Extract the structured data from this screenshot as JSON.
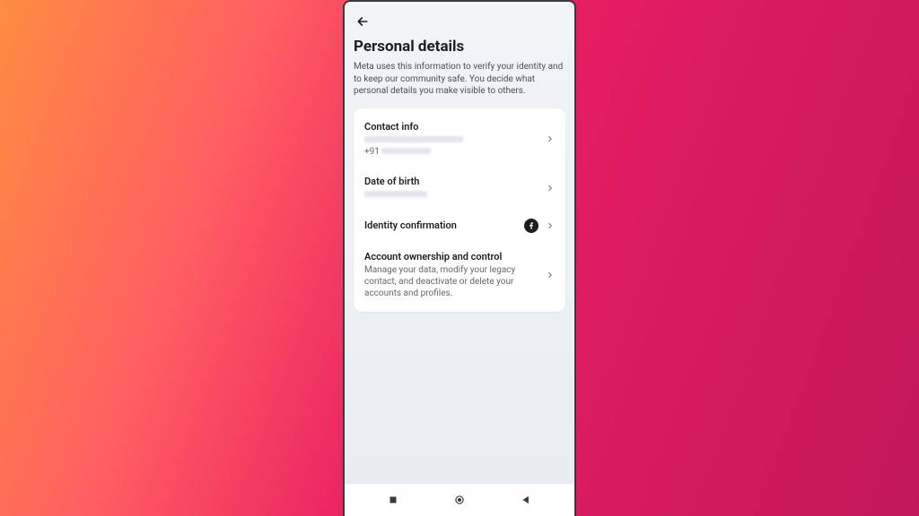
{
  "page": {
    "title": "Personal details",
    "subtitle": "Meta uses this information to verify your identity and to keep our community safe. You decide what personal details you make visible to others."
  },
  "sections": {
    "contact": {
      "title": "Contact info",
      "phone_prefix": "+91"
    },
    "dob": {
      "title": "Date of birth"
    },
    "identity": {
      "title": "Identity confirmation"
    },
    "ownership": {
      "title": "Account ownership and control",
      "description": "Manage your data, modify your legacy contact, and deactivate or delete your accounts and profiles."
    }
  }
}
